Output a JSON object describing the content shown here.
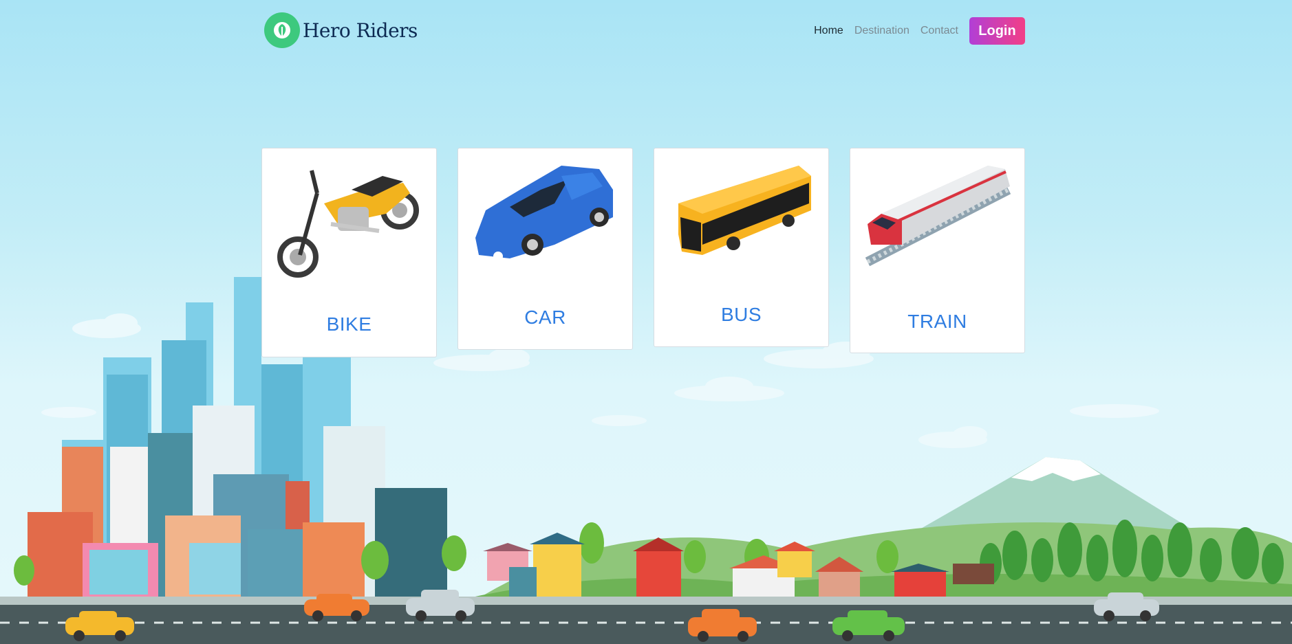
{
  "brand": {
    "name": "Hero Riders",
    "logo_icon": "leaf-icon",
    "color": "#3dc97e"
  },
  "nav": {
    "items": [
      {
        "label": "Home",
        "active": true
      },
      {
        "label": "Destination",
        "active": false
      },
      {
        "label": "Contact",
        "active": false
      }
    ],
    "login_label": "Login"
  },
  "vehicles": [
    {
      "label": "BIKE",
      "icon": "motorcycle-icon",
      "color": "#f2b31e"
    },
    {
      "label": "CAR",
      "icon": "car-icon",
      "color": "#2f6fd6"
    },
    {
      "label": "BUS",
      "icon": "bus-icon",
      "color": "#f7b21f"
    },
    {
      "label": "TRAIN",
      "icon": "train-icon",
      "color": "#d9333f"
    }
  ],
  "colors": {
    "accent": "#2f7de1",
    "login_start": "#b13fd6",
    "login_end": "#f23f87",
    "road": "#4a5a5c"
  }
}
